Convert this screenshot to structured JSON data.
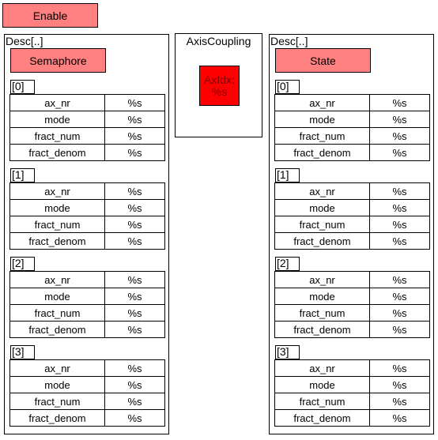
{
  "enable_button": {
    "label": "Enable"
  },
  "left_panel": {
    "title": "Desc[..]",
    "button_label": "Semaphore",
    "groups": [
      {
        "index": "[0]",
        "rows": [
          [
            "ax_nr",
            "%s"
          ],
          [
            "mode",
            "%s"
          ],
          [
            "fract_num",
            "%s"
          ],
          [
            "fract_denom",
            "%s"
          ]
        ]
      },
      {
        "index": "[1]",
        "rows": [
          [
            "ax_nr",
            "%s"
          ],
          [
            "mode",
            "%s"
          ],
          [
            "fract_num",
            "%s"
          ],
          [
            "fract_denom",
            "%s"
          ]
        ]
      },
      {
        "index": "[2]",
        "rows": [
          [
            "ax_nr",
            "%s"
          ],
          [
            "mode",
            "%s"
          ],
          [
            "fract_num",
            "%s"
          ],
          [
            "fract_denom",
            "%s"
          ]
        ]
      },
      {
        "index": "[3]",
        "rows": [
          [
            "ax_nr",
            "%s"
          ],
          [
            "mode",
            "%s"
          ],
          [
            "fract_num",
            "%s"
          ],
          [
            "fract_denom",
            "%s"
          ]
        ]
      }
    ]
  },
  "coupling": {
    "title": "AxisCoupling",
    "indicator_label": "AxIdx:",
    "indicator_value": "%s",
    "indicator_color": "#ff0000"
  },
  "right_panel": {
    "title": "Desc[..]",
    "button_label": "State",
    "groups": [
      {
        "index": "[0]",
        "rows": [
          [
            "ax_nr",
            "%s"
          ],
          [
            "mode",
            "%s"
          ],
          [
            "fract_num",
            "%s"
          ],
          [
            "fract_denom",
            "%s"
          ]
        ]
      },
      {
        "index": "[1]",
        "rows": [
          [
            "ax_nr",
            "%s"
          ],
          [
            "mode",
            "%s"
          ],
          [
            "fract_num",
            "%s"
          ],
          [
            "fract_denom",
            "%s"
          ]
        ]
      },
      {
        "index": "[2]",
        "rows": [
          [
            "ax_nr",
            "%s"
          ],
          [
            "mode",
            "%s"
          ],
          [
            "fract_num",
            "%s"
          ],
          [
            "fract_denom",
            "%s"
          ]
        ]
      },
      {
        "index": "[3]",
        "rows": [
          [
            "ax_nr",
            "%s"
          ],
          [
            "mode",
            "%s"
          ],
          [
            "fract_num",
            "%s"
          ],
          [
            "fract_denom",
            "%s"
          ]
        ]
      }
    ]
  },
  "colors": {
    "button": "#ff8080",
    "indicator": "#ff0000"
  }
}
